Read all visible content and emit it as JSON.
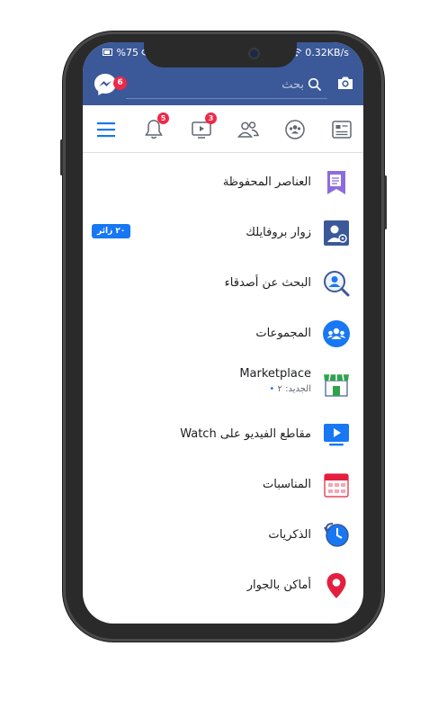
{
  "status_bar": {
    "battery": "%75",
    "speed": "0.32KB/s"
  },
  "header": {
    "messenger_badge": "6",
    "search_placeholder": "بحث"
  },
  "tabs": [
    {
      "name": "menu",
      "badge": ""
    },
    {
      "name": "notifications",
      "badge": "5"
    },
    {
      "name": "watch",
      "badge": "3"
    },
    {
      "name": "friends",
      "badge": ""
    },
    {
      "name": "groups",
      "badge": ""
    },
    {
      "name": "news-feed",
      "badge": ""
    }
  ],
  "menu": {
    "saved": "العناصر المحفوظة",
    "profile_visitors": "زوار بروفايلك",
    "visitors_badge": "٢٠ زائر",
    "find_friends": "البحث عن أصدقاء",
    "groups": "المجموعات",
    "marketplace": "Marketplace",
    "marketplace_sub": "الجديد: ٢",
    "watch_videos": "مقاطع الفيديو على Watch",
    "events": "المناسبات",
    "memories": "الذكريات",
    "nearby_places": "أماكن بالجوار"
  },
  "colors": {
    "brand": "#3b5998",
    "badge": "#f02849",
    "accent": "#1877f2"
  }
}
